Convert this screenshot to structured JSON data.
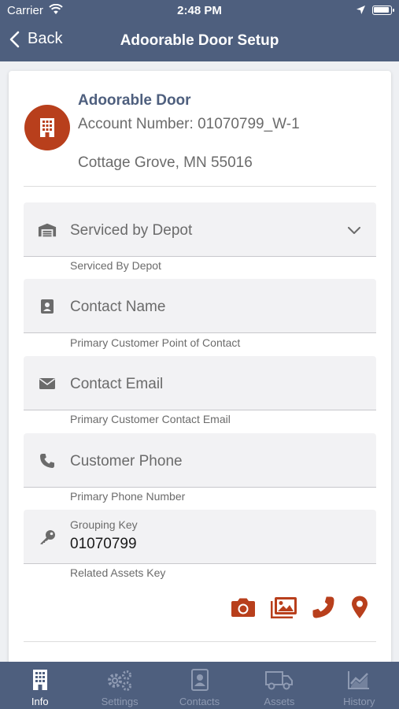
{
  "status_bar": {
    "carrier": "Carrier",
    "time": "2:48 PM"
  },
  "nav": {
    "back_label": "Back",
    "title": "Adoorable Door Setup"
  },
  "account": {
    "name": "Adoorable Door",
    "number": "Account Number: 01070799_W-1",
    "address": "Cottage Grove, MN 55016"
  },
  "fields": {
    "depot": {
      "placeholder": "Serviced by Depot",
      "helper": "Serviced By Depot",
      "icon": "warehouse-icon"
    },
    "contact_name": {
      "placeholder": "Contact Name",
      "helper": "Primary Customer Point of Contact",
      "icon": "contact-card-icon"
    },
    "contact_email": {
      "placeholder": "Contact Email",
      "helper": "Primary Customer Contact Email",
      "icon": "envelope-icon"
    },
    "customer_phone": {
      "placeholder": "Customer Phone",
      "helper": "Primary Phone Number",
      "icon": "phone-icon"
    },
    "grouping_key": {
      "label": "Grouping Key",
      "value": "01070799",
      "helper": "Related Assets Key",
      "icon": "key-icon"
    }
  },
  "actions": [
    "camera-icon",
    "photo-gallery-icon",
    "phone-icon",
    "map-pin-icon"
  ],
  "tabs": [
    {
      "label": "Info",
      "icon": "building-icon",
      "active": true
    },
    {
      "label": "Settings",
      "icon": "gears-icon",
      "active": false
    },
    {
      "label": "Contacts",
      "icon": "contact-card-icon",
      "active": false
    },
    {
      "label": "Assets",
      "icon": "truck-icon",
      "active": false
    },
    {
      "label": "History",
      "icon": "chart-line-icon",
      "active": false
    }
  ],
  "colors": {
    "primary": "#4e5f7e",
    "accent": "#b83f1c",
    "tab_inactive": "#8e9ab2",
    "field_background": "#f2f2f4",
    "muted_text": "#6b6b6b"
  }
}
